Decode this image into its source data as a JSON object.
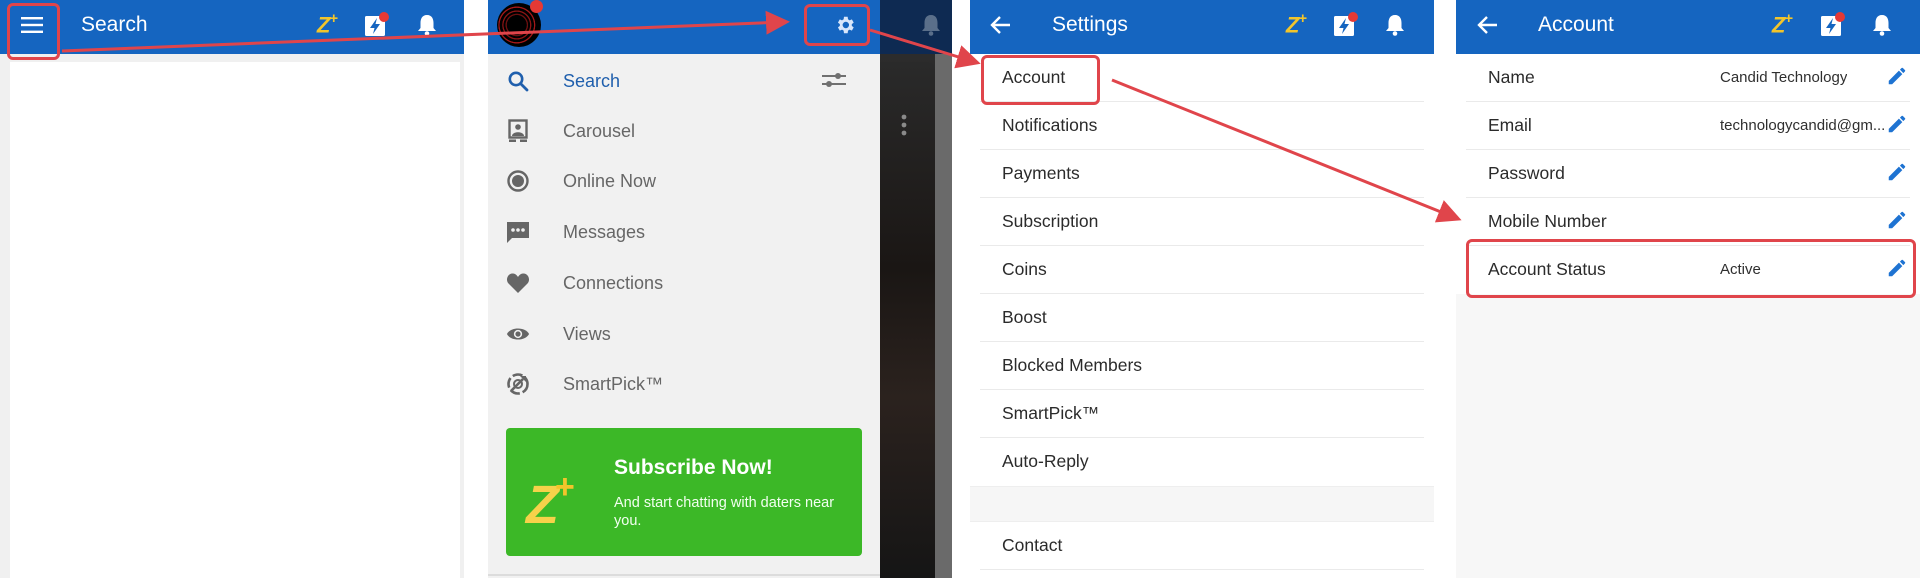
{
  "panels": {
    "search_screen": {
      "title": "Search",
      "icons": [
        "menu-icon",
        "zplus-icon",
        "boost-icon",
        "bell-icon"
      ],
      "zplus_label": "Z",
      "zplus_plus": "+"
    },
    "drawer_screen": {
      "icons": [
        "avatar",
        "settings-gear-icon",
        "bell-icon"
      ],
      "items": [
        {
          "label": "Search",
          "icon": "search-icon",
          "active": true
        },
        {
          "label": "Carousel",
          "icon": "carousel-icon"
        },
        {
          "label": "Online Now",
          "icon": "online-now-icon"
        },
        {
          "label": "Messages",
          "icon": "messages-icon"
        },
        {
          "label": "Connections",
          "icon": "heart-icon"
        },
        {
          "label": "Views",
          "icon": "eye-icon"
        },
        {
          "label": "SmartPick™",
          "icon": "smartpick-icon"
        }
      ],
      "filter_icon": "filter-sliders-icon",
      "promo": {
        "logo": "Z",
        "logo_plus": "+",
        "heading": "Subscribe Now!",
        "subtext": "And start chatting with daters near you."
      }
    },
    "settings_screen": {
      "title": "Settings",
      "back_icon": "back-arrow-icon",
      "zplus_label": "Z",
      "zplus_plus": "+",
      "items": [
        "Account",
        "Notifications",
        "Payments",
        "Subscription",
        "Coins",
        "Boost",
        "Blocked Members",
        "SmartPick™",
        "Auto-Reply"
      ],
      "section2_items": [
        "Contact"
      ]
    },
    "account_screen": {
      "title": "Account",
      "back_icon": "back-arrow-icon",
      "zplus_label": "Z",
      "zplus_plus": "+",
      "rows": [
        {
          "label": "Name",
          "value": "Candid Technology"
        },
        {
          "label": "Email",
          "value": "technologycandid@gm..."
        },
        {
          "label": "Password",
          "value": ""
        },
        {
          "label": "Mobile Number",
          "value": ""
        },
        {
          "label": "Account Status",
          "value": "Active"
        }
      ]
    }
  },
  "colors": {
    "appbar": "#1565c0",
    "accent_yellow": "#f2c52b",
    "promo_green": "#3cb827",
    "annotation_red": "#e0454b",
    "notification_dot": "#e53935",
    "edit_icon_blue": "#1e73d2"
  },
  "annotations": {
    "highlighted": [
      "menu-button",
      "settings-gear-button",
      "settings-item-account",
      "account-row-account-status"
    ],
    "arrows": [
      "menu-to-gear",
      "gear-to-account",
      "account-to-account-status"
    ]
  }
}
